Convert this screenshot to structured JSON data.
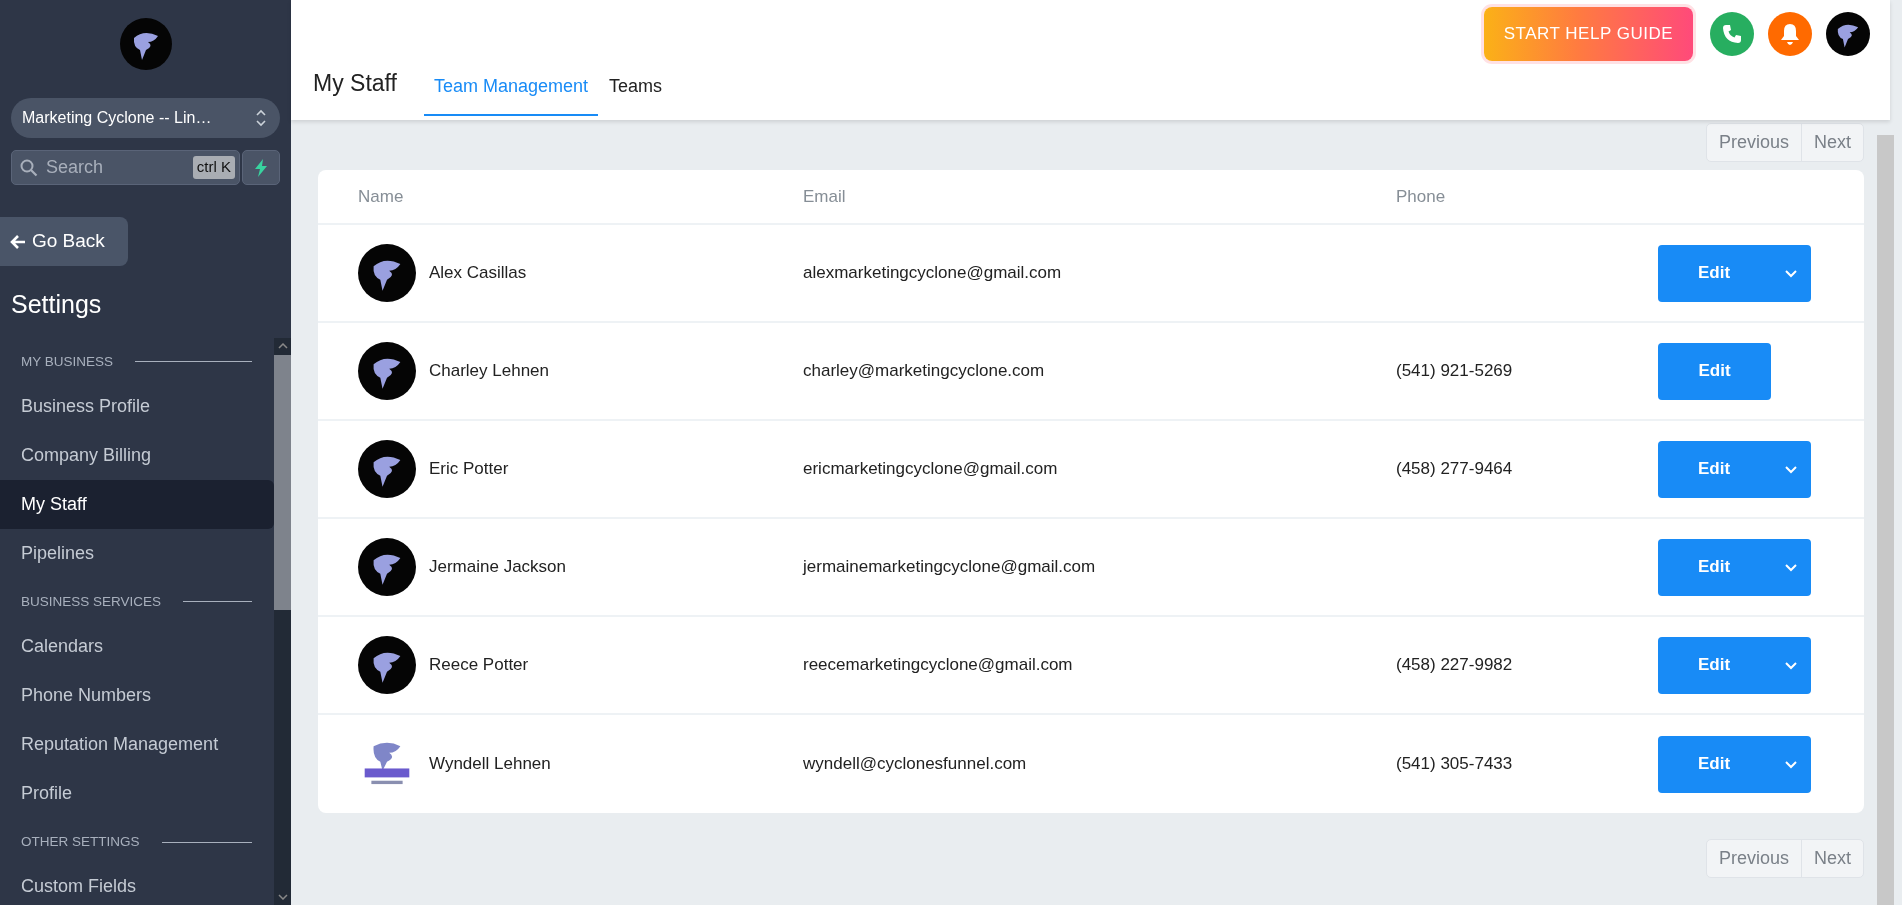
{
  "sidebar": {
    "org_selector": {
      "value": "Marketing Cyclone -- Lin…"
    },
    "search": {
      "placeholder": "Search",
      "shortcut": "ctrl K"
    },
    "back_button": "Go Back",
    "title": "Settings",
    "sections": [
      {
        "heading": "MY BUSINESS",
        "items": [
          {
            "label": "Business Profile",
            "selected": false
          },
          {
            "label": "Company Billing",
            "selected": false
          },
          {
            "label": "My Staff",
            "selected": true
          },
          {
            "label": "Pipelines",
            "selected": false
          }
        ]
      },
      {
        "heading": "BUSINESS SERVICES",
        "items": [
          {
            "label": "Calendars",
            "selected": false
          },
          {
            "label": "Phone Numbers",
            "selected": false
          },
          {
            "label": "Reputation Management",
            "selected": false
          },
          {
            "label": "Profile",
            "selected": false
          }
        ]
      },
      {
        "heading": "OTHER SETTINGS",
        "items": [
          {
            "label": "Custom Fields",
            "selected": false
          }
        ]
      }
    ]
  },
  "header": {
    "help_button": "START HELP GUIDE",
    "title": "My Staff",
    "tabs": [
      {
        "label": "Team Management",
        "selected": true
      },
      {
        "label": "Teams",
        "selected": false
      }
    ]
  },
  "pagination_top": {
    "previous": "Previous",
    "next": "Next"
  },
  "table": {
    "columns": [
      "Name",
      "Email",
      "Phone"
    ],
    "rows": [
      {
        "name": "Alex Casillas",
        "email": "alexmarketingcyclone@gmail.com",
        "action": "Edit",
        "has_menu": true,
        "kind": "dark"
      },
      {
        "name": "Charley Lehnen",
        "email": "charley@marketingcyclone.com",
        "phone": "(541) 921-5269",
        "action": "Edit",
        "has_menu": false,
        "kind": "dark"
      },
      {
        "name": "Eric Potter",
        "email": "ericmarketingcyclone@gmail.com",
        "phone": "(458) 277-9464",
        "action": "Edit",
        "has_menu": true,
        "kind": "dark"
      },
      {
        "name": "Jermaine Jackson",
        "email": "jermainemarketingcyclone@gmail.com",
        "action": "Edit",
        "has_menu": true,
        "kind": "dark"
      },
      {
        "name": "Reece Potter",
        "email": "reecemarketingcyclone@gmail.com",
        "phone": "(458) 227-9982",
        "action": "Edit",
        "has_menu": true,
        "kind": "dark"
      },
      {
        "name": "Wyndell Lehnen",
        "email": "wyndell@cyclonesfunnel.com",
        "phone": "(541) 305-7433",
        "action": "Edit",
        "has_menu": true,
        "kind": "light"
      }
    ]
  },
  "pagination_bottom": {
    "previous": "Previous",
    "next": "Next"
  }
}
